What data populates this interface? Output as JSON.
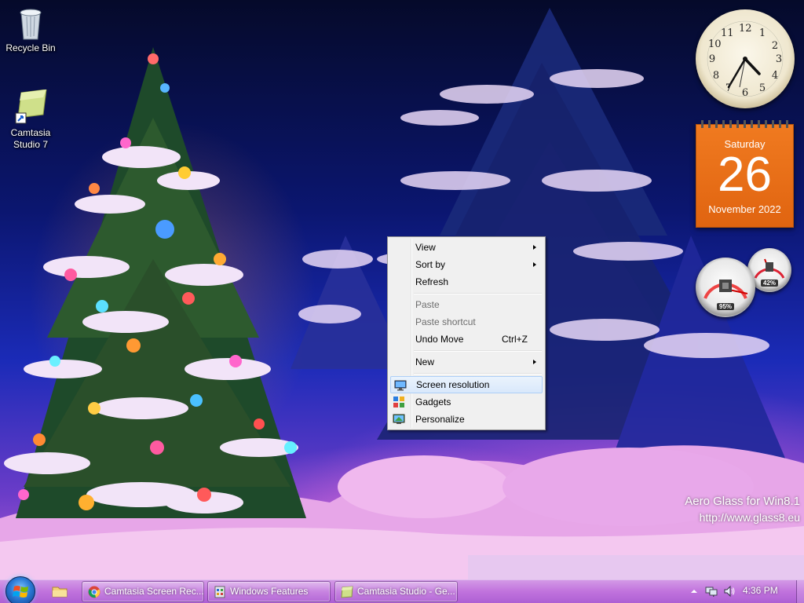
{
  "desktop": {
    "icons": [
      {
        "label": "Recycle Bin",
        "icon": "recycle-bin-icon"
      },
      {
        "label": "Camtasia\nStudio 7",
        "icon": "camtasia-shortcut-icon"
      }
    ],
    "watermark": {
      "line1": "Aero Glass for Win8.1",
      "line2": "http://www.glass8.eu"
    }
  },
  "gadgets": {
    "clock": {
      "numbers": [
        "12",
        "1",
        "2",
        "3",
        "4",
        "5",
        "6",
        "7",
        "8",
        "9",
        "10",
        "11"
      ],
      "time": "4:36"
    },
    "calendar": {
      "day": "Saturday",
      "date": "26",
      "month": "November 2022"
    },
    "cpu_meter": {
      "cpu_percent": "95%",
      "memory_percent": "42%",
      "cpu_value": 0.95,
      "memory_value": 0.42
    }
  },
  "context_menu": {
    "items": [
      {
        "label": "View",
        "submenu": true,
        "disabled": false
      },
      {
        "label": "Sort by",
        "submenu": true,
        "disabled": false
      },
      {
        "label": "Refresh",
        "submenu": false,
        "disabled": false
      },
      {
        "label": "Paste",
        "submenu": false,
        "disabled": true
      },
      {
        "label": "Paste shortcut",
        "submenu": false,
        "disabled": true
      },
      {
        "label": "Undo Move",
        "shortcut": "Ctrl+Z",
        "submenu": false,
        "disabled": false
      },
      {
        "label": "New",
        "submenu": true,
        "disabled": false
      },
      {
        "label": "Screen resolution",
        "icon": "screen-resolution-icon",
        "highlighted": true
      },
      {
        "label": "Gadgets",
        "icon": "gadgets-icon"
      },
      {
        "label": "Personalize",
        "icon": "personalize-icon"
      }
    ]
  },
  "taskbar": {
    "buttons": [
      {
        "label": "Camtasia Screen Rec...",
        "icon": "chrome-icon"
      },
      {
        "label": "Windows Features",
        "icon": "windows-features-icon"
      },
      {
        "label": "Camtasia Studio - Ge...",
        "icon": "camtasia-icon"
      }
    ],
    "clock": "4:36 PM",
    "colors": {
      "taskbar": "#c47ae0",
      "accent": "#2c7ad6"
    }
  }
}
